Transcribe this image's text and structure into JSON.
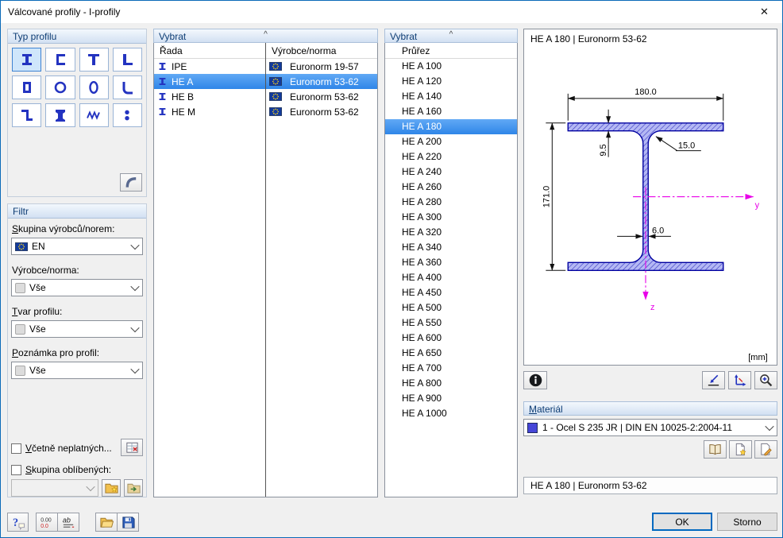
{
  "window": {
    "title": "Válcované profily - I-profily"
  },
  "type_panel": {
    "header": "Typ profilu",
    "buttons": [
      {
        "name": "i-profile",
        "icon": "i-profile",
        "selected": true
      },
      {
        "name": "u-profile",
        "icon": "u-profile",
        "selected": false
      },
      {
        "name": "t-profile",
        "icon": "t-profile",
        "selected": false
      },
      {
        "name": "l-profile",
        "icon": "l-profile",
        "selected": false
      },
      {
        "name": "hollow-box-profile",
        "icon": "box-profile",
        "selected": false
      },
      {
        "name": "pipe-profile",
        "icon": "pipe-profile",
        "selected": false
      },
      {
        "name": "oval-profile",
        "icon": "oval-profile",
        "selected": false
      },
      {
        "name": "angle-profile",
        "icon": "angle-profile",
        "selected": false
      },
      {
        "name": "z-profile",
        "icon": "z-profile",
        "selected": false
      },
      {
        "name": "rail-profile",
        "icon": "rail-profile",
        "selected": false
      },
      {
        "name": "corrugated-profile",
        "icon": "corrugated-profile",
        "selected": false
      },
      {
        "name": "round-bar-profile",
        "icon": "round-bar-profile",
        "selected": false
      }
    ]
  },
  "filter_panel": {
    "header": "Filtr",
    "group_label": "Skupina výrobců/norem:",
    "group_value": "EN",
    "vendor_label": "Výrobce/norma:",
    "vendor_value": "Vše",
    "shape_label": "Tvar profilu:",
    "shape_value": "Vše",
    "note_label": "Poznámka pro profil:",
    "note_value": "Vše",
    "include_invalid_label": "Včetně neplatných...",
    "favorites_label": "Skupina oblíbených:"
  },
  "series_panel": {
    "header": "Vybrat",
    "columns": [
      "Řada",
      "Výrobce/norma"
    ],
    "rows": [
      {
        "series": "IPE",
        "norm": "Euronorm 19-57",
        "selected": false
      },
      {
        "series": "HE A",
        "norm": "Euronorm 53-62",
        "selected": true
      },
      {
        "series": "HE B",
        "norm": "Euronorm 53-62",
        "selected": false
      },
      {
        "series": "HE M",
        "norm": "Euronorm 53-62",
        "selected": false
      }
    ]
  },
  "size_panel": {
    "header": "Vybrat",
    "column": "Průřez",
    "selected_index": 4,
    "items": [
      "HE A 100",
      "HE A 120",
      "HE A 140",
      "HE A 160",
      "HE A 180",
      "HE A 200",
      "HE A 220",
      "HE A 240",
      "HE A 260",
      "HE A 280",
      "HE A 300",
      "HE A 320",
      "HE A 340",
      "HE A 360",
      "HE A 400",
      "HE A 450",
      "HE A 500",
      "HE A 550",
      "HE A 600",
      "HE A 650",
      "HE A 700",
      "HE A 800",
      "HE A 900",
      "HE A 1000"
    ]
  },
  "preview": {
    "title": "HE A 180 | Euronorm 53-62",
    "unit": "[mm]",
    "axes": {
      "horizontal": "y",
      "vertical": "z"
    },
    "dimensions": {
      "width": "180.0",
      "height": "171.0",
      "flange_thickness": "9.5",
      "web_thickness": "6.0",
      "fillet_radius": "15.0"
    }
  },
  "material": {
    "header": "Materiál",
    "value": "1 - Ocel S 235 JR | DIN EN 10025-2:2004-11"
  },
  "result_value": "HE A 180 | Euronorm 53-62",
  "footer": {
    "ok": "OK",
    "cancel": "Storno"
  },
  "colors": {
    "selection": "#2f86e8",
    "accent_blue": "#2333c0",
    "profile_fill": "#b4b8f4",
    "profile_hatch": "#4646c8",
    "axis_magenta": "#e800e8",
    "material_swatch": "#4646d8"
  }
}
